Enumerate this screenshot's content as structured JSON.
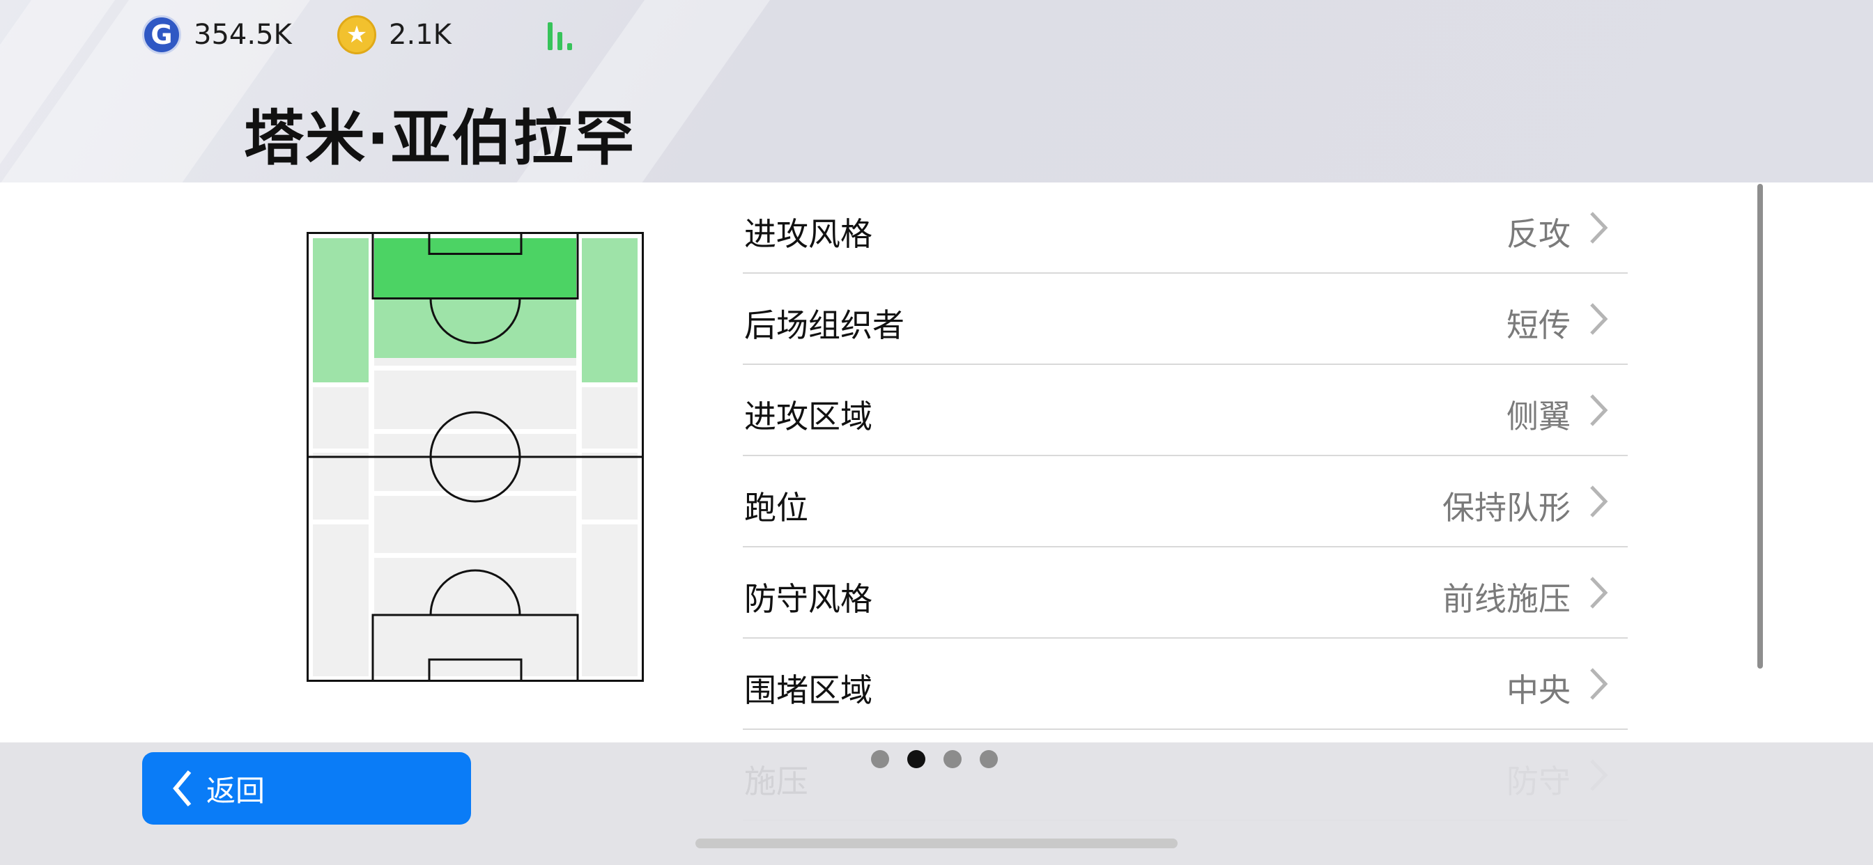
{
  "header": {
    "currencies": [
      {
        "icon": "g-coin-icon",
        "value": "354.5K"
      },
      {
        "icon": "star-coin-icon",
        "value": "2.1K"
      }
    ],
    "signal_icon": "signal-bars-icon",
    "player_name": "塔米·亚伯拉罕"
  },
  "settings": [
    {
      "label": "进攻风格",
      "value": "反攻"
    },
    {
      "label": "后场组织者",
      "value": "短传"
    },
    {
      "label": "进攻区域",
      "value": "侧翼"
    },
    {
      "label": "跑位",
      "value": "保持队形"
    },
    {
      "label": "防守风格",
      "value": "前线施压"
    },
    {
      "label": "围堵区域",
      "value": "中央"
    },
    {
      "label": "施压",
      "value": "防守"
    }
  ],
  "footer": {
    "back_label": "返回",
    "page_indicator": {
      "total": 4,
      "active": 2
    }
  },
  "colors": {
    "accent": "#0a7cf7",
    "zone_dark_green": "#4cd364",
    "zone_light_green": "#9ee3a8",
    "pitch_gray": "#f0f0f0"
  }
}
